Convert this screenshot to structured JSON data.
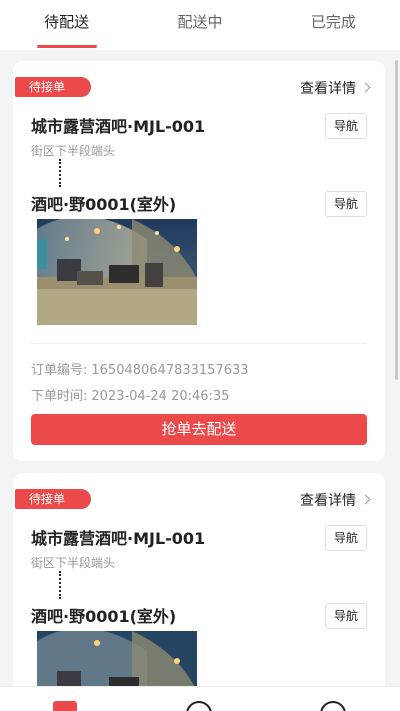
{
  "tabs": [
    {
      "label": "待配送",
      "active": true
    },
    {
      "label": "配送中",
      "active": false
    },
    {
      "label": "已完成",
      "active": false
    }
  ],
  "orders": [
    {
      "badge": "待接单",
      "detail_link": "查看详情",
      "shop_name": "城市露营酒吧·MJL-001",
      "shop_address": "街区下半段端头",
      "nav_label": "导航",
      "dest_name": "酒吧·野0001(室外)",
      "order_no_label": "订单编号:",
      "order_no": "1650480647833157633",
      "order_time_label": "下单时间:",
      "order_time": "2023-04-24 20:46:35",
      "grab_button": "抢单去配送"
    },
    {
      "badge": "待接单",
      "detail_link": "查看详情",
      "shop_name": "城市露营酒吧·MJL-001",
      "shop_address": "街区下半段端头",
      "nav_label": "导航",
      "dest_name": "酒吧·野0001(室外)"
    }
  ],
  "bottom_nav": [
    {
      "icon": "orders-icon"
    },
    {
      "icon": "circle-icon"
    },
    {
      "icon": "profile-icon"
    }
  ],
  "colors": {
    "accent": "#ec4a4a",
    "background": "#f4f4f6"
  }
}
